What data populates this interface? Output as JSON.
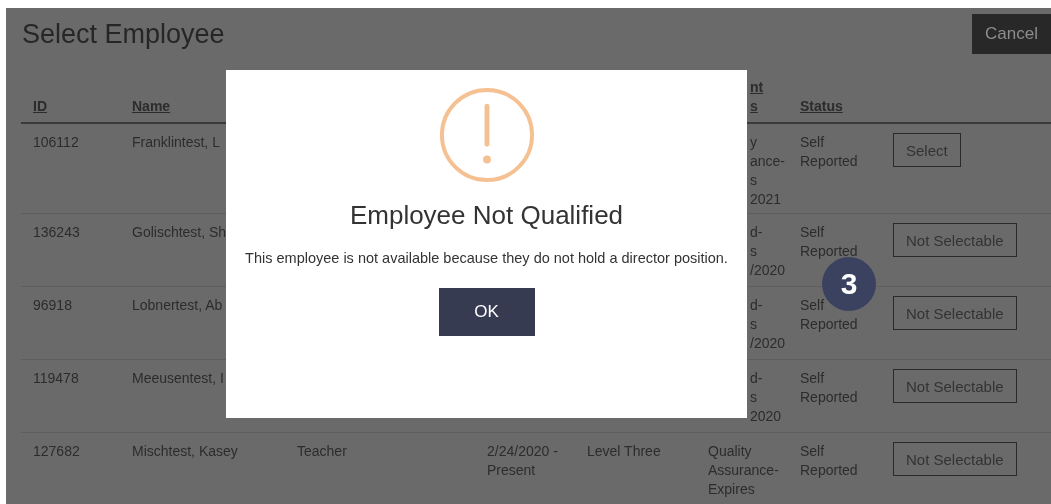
{
  "page": {
    "title": "Select Employee",
    "cancel": "Cancel"
  },
  "table": {
    "columns": [
      {
        "label": "ID",
        "kind": "full"
      },
      {
        "label": "Name",
        "kind": "full"
      },
      {
        "kind": "hidden"
      },
      {
        "kind": "hidden"
      },
      {
        "kind": "hidden"
      },
      {
        "lines": [
          "nt",
          "s"
        ],
        "kind": "fragment"
      },
      {
        "label": "Status",
        "kind": "full"
      },
      {
        "kind": "hidden"
      }
    ],
    "rows": [
      {
        "id": "106112",
        "name": "Franklintest, L",
        "qualification": {
          "kind": "fragment",
          "lines": [
            "y",
            "ance-",
            "s",
            "2021"
          ]
        },
        "status": [
          "Self",
          "Reported"
        ],
        "action": "Select"
      },
      {
        "id": "136243",
        "name": "Golischtest, Sh",
        "qualification": {
          "kind": "fragment",
          "lines": [
            "d-",
            "s",
            "/2020"
          ]
        },
        "status": [
          "Self",
          "Reported"
        ],
        "action": "Not Selectable"
      },
      {
        "id": "96918",
        "name": "Lobnertest, Ab",
        "qualification": {
          "kind": "fragment",
          "lines": [
            "d-",
            "s",
            "/2020"
          ]
        },
        "status": [
          "Self",
          "Reported"
        ],
        "action": "Not Selectable"
      },
      {
        "id": "119478",
        "name": "Meeusentest, I",
        "qualification": {
          "kind": "fragment",
          "lines": [
            "d-",
            "s",
            "2020"
          ]
        },
        "status": [
          "Self",
          "Reported"
        ],
        "action": "Not Selectable"
      },
      {
        "id": "127682",
        "name": "Mischtest, Kasey",
        "position": "Teacher",
        "dates": [
          "2/24/2020 -",
          "Present"
        ],
        "level": "Level Three",
        "qualification": {
          "kind": "full",
          "lines": [
            "Quality",
            "Assurance-",
            "Expires"
          ]
        },
        "status": [
          "Self",
          "Reported"
        ],
        "action": "Not Selectable"
      }
    ]
  },
  "dialog": {
    "title": "Employee Not Qualified",
    "message": "This employee is not available because they do not hold a director position.",
    "button": "OK"
  },
  "callout": "3"
}
